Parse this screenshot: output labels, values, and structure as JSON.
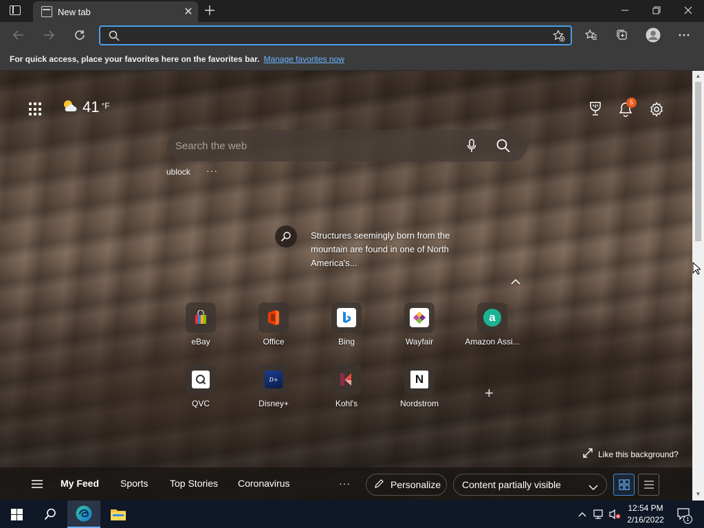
{
  "browser": {
    "tab_title": "New tab",
    "address_value": "",
    "favorites_bar_text": "For quick access, place your favorites here on the favorites bar.",
    "favorites_bar_link": "Manage favorites now"
  },
  "newtab": {
    "weather_temp": "41",
    "weather_unit": "°F",
    "notification_count": "5",
    "search_placeholder": "Search the web",
    "quick_link": "ublock",
    "quick_link_more": "···",
    "background_info": "Structures seemingly born from the mountain are found in one of North America's...",
    "tiles": [
      {
        "label": "eBay"
      },
      {
        "label": "Office"
      },
      {
        "label": "Bing"
      },
      {
        "label": "Wayfair"
      },
      {
        "label": "Amazon Assi..."
      },
      {
        "label": "QVC"
      },
      {
        "label": "Disney+"
      },
      {
        "label": "Kohl's"
      },
      {
        "label": "Nordstrom"
      }
    ],
    "like_background": "Like this background?"
  },
  "feed": {
    "tabs": [
      "My Feed",
      "Sports",
      "Top Stories",
      "Coronavirus"
    ],
    "more": "···",
    "personalize": "Personalize",
    "content_visibility": "Content partially visible"
  },
  "taskbar": {
    "time": "12:54 PM",
    "date": "2/16/2022",
    "notification_badge": "1"
  },
  "colors": {
    "accent": "#4a9fe8",
    "chrome_dark": "#202020",
    "chrome_mid": "#3b3b3b",
    "taskbar": "#101827",
    "badge": "#e8581e"
  }
}
